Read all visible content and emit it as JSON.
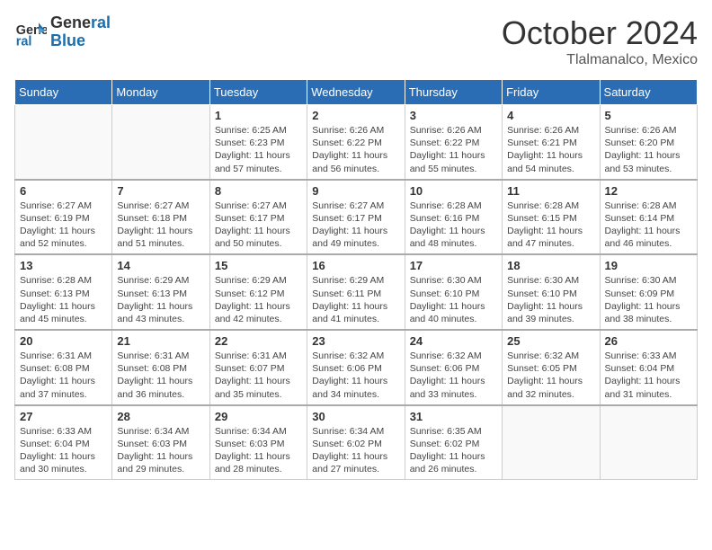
{
  "header": {
    "logo_line1": "General",
    "logo_line2": "Blue",
    "month": "October 2024",
    "location": "Tlalmanalco, Mexico"
  },
  "weekdays": [
    "Sunday",
    "Monday",
    "Tuesday",
    "Wednesday",
    "Thursday",
    "Friday",
    "Saturday"
  ],
  "weeks": [
    [
      {
        "day": "",
        "info": ""
      },
      {
        "day": "",
        "info": ""
      },
      {
        "day": "1",
        "info": "Sunrise: 6:25 AM\nSunset: 6:23 PM\nDaylight: 11 hours and 57 minutes."
      },
      {
        "day": "2",
        "info": "Sunrise: 6:26 AM\nSunset: 6:22 PM\nDaylight: 11 hours and 56 minutes."
      },
      {
        "day": "3",
        "info": "Sunrise: 6:26 AM\nSunset: 6:22 PM\nDaylight: 11 hours and 55 minutes."
      },
      {
        "day": "4",
        "info": "Sunrise: 6:26 AM\nSunset: 6:21 PM\nDaylight: 11 hours and 54 minutes."
      },
      {
        "day": "5",
        "info": "Sunrise: 6:26 AM\nSunset: 6:20 PM\nDaylight: 11 hours and 53 minutes."
      }
    ],
    [
      {
        "day": "6",
        "info": "Sunrise: 6:27 AM\nSunset: 6:19 PM\nDaylight: 11 hours and 52 minutes."
      },
      {
        "day": "7",
        "info": "Sunrise: 6:27 AM\nSunset: 6:18 PM\nDaylight: 11 hours and 51 minutes."
      },
      {
        "day": "8",
        "info": "Sunrise: 6:27 AM\nSunset: 6:17 PM\nDaylight: 11 hours and 50 minutes."
      },
      {
        "day": "9",
        "info": "Sunrise: 6:27 AM\nSunset: 6:17 PM\nDaylight: 11 hours and 49 minutes."
      },
      {
        "day": "10",
        "info": "Sunrise: 6:28 AM\nSunset: 6:16 PM\nDaylight: 11 hours and 48 minutes."
      },
      {
        "day": "11",
        "info": "Sunrise: 6:28 AM\nSunset: 6:15 PM\nDaylight: 11 hours and 47 minutes."
      },
      {
        "day": "12",
        "info": "Sunrise: 6:28 AM\nSunset: 6:14 PM\nDaylight: 11 hours and 46 minutes."
      }
    ],
    [
      {
        "day": "13",
        "info": "Sunrise: 6:28 AM\nSunset: 6:13 PM\nDaylight: 11 hours and 45 minutes."
      },
      {
        "day": "14",
        "info": "Sunrise: 6:29 AM\nSunset: 6:13 PM\nDaylight: 11 hours and 43 minutes."
      },
      {
        "day": "15",
        "info": "Sunrise: 6:29 AM\nSunset: 6:12 PM\nDaylight: 11 hours and 42 minutes."
      },
      {
        "day": "16",
        "info": "Sunrise: 6:29 AM\nSunset: 6:11 PM\nDaylight: 11 hours and 41 minutes."
      },
      {
        "day": "17",
        "info": "Sunrise: 6:30 AM\nSunset: 6:10 PM\nDaylight: 11 hours and 40 minutes."
      },
      {
        "day": "18",
        "info": "Sunrise: 6:30 AM\nSunset: 6:10 PM\nDaylight: 11 hours and 39 minutes."
      },
      {
        "day": "19",
        "info": "Sunrise: 6:30 AM\nSunset: 6:09 PM\nDaylight: 11 hours and 38 minutes."
      }
    ],
    [
      {
        "day": "20",
        "info": "Sunrise: 6:31 AM\nSunset: 6:08 PM\nDaylight: 11 hours and 37 minutes."
      },
      {
        "day": "21",
        "info": "Sunrise: 6:31 AM\nSunset: 6:08 PM\nDaylight: 11 hours and 36 minutes."
      },
      {
        "day": "22",
        "info": "Sunrise: 6:31 AM\nSunset: 6:07 PM\nDaylight: 11 hours and 35 minutes."
      },
      {
        "day": "23",
        "info": "Sunrise: 6:32 AM\nSunset: 6:06 PM\nDaylight: 11 hours and 34 minutes."
      },
      {
        "day": "24",
        "info": "Sunrise: 6:32 AM\nSunset: 6:06 PM\nDaylight: 11 hours and 33 minutes."
      },
      {
        "day": "25",
        "info": "Sunrise: 6:32 AM\nSunset: 6:05 PM\nDaylight: 11 hours and 32 minutes."
      },
      {
        "day": "26",
        "info": "Sunrise: 6:33 AM\nSunset: 6:04 PM\nDaylight: 11 hours and 31 minutes."
      }
    ],
    [
      {
        "day": "27",
        "info": "Sunrise: 6:33 AM\nSunset: 6:04 PM\nDaylight: 11 hours and 30 minutes."
      },
      {
        "day": "28",
        "info": "Sunrise: 6:34 AM\nSunset: 6:03 PM\nDaylight: 11 hours and 29 minutes."
      },
      {
        "day": "29",
        "info": "Sunrise: 6:34 AM\nSunset: 6:03 PM\nDaylight: 11 hours and 28 minutes."
      },
      {
        "day": "30",
        "info": "Sunrise: 6:34 AM\nSunset: 6:02 PM\nDaylight: 11 hours and 27 minutes."
      },
      {
        "day": "31",
        "info": "Sunrise: 6:35 AM\nSunset: 6:02 PM\nDaylight: 11 hours and 26 minutes."
      },
      {
        "day": "",
        "info": ""
      },
      {
        "day": "",
        "info": ""
      }
    ]
  ]
}
